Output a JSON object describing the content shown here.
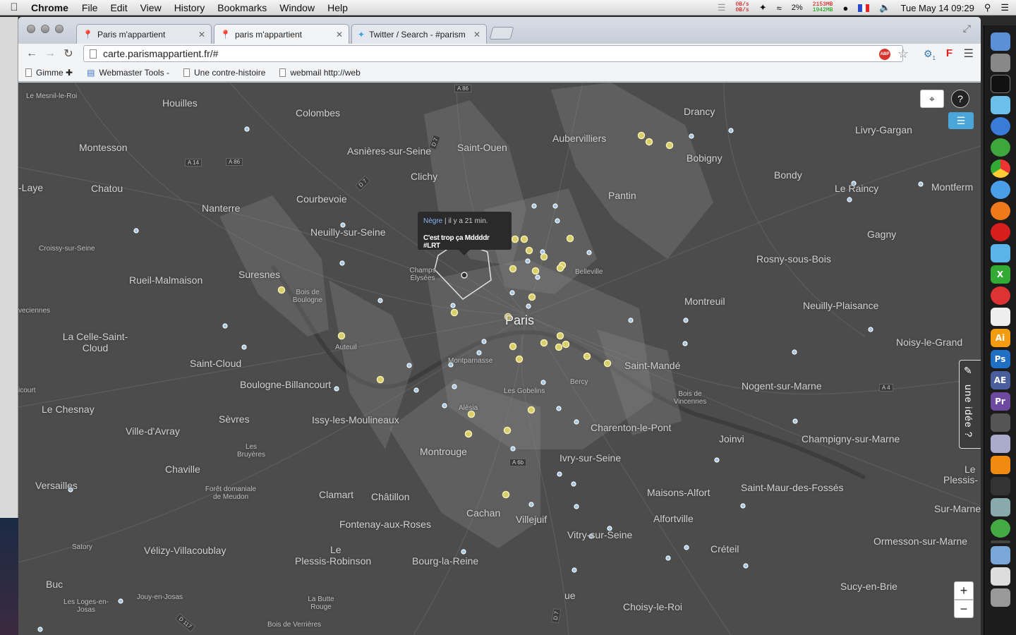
{
  "menubar": {
    "apple": "",
    "app": "Chrome",
    "items": [
      "File",
      "Edit",
      "View",
      "History",
      "Bookmarks",
      "Window",
      "Help"
    ],
    "net_up": "0B/s",
    "net_down": "0B/s",
    "mem_used": "2153MB",
    "mem_free": "1942MB",
    "battery": "2%",
    "datetime": "Tue May 14  09:29"
  },
  "tabs": [
    {
      "title": "Paris m'appartient",
      "active": false
    },
    {
      "title": "paris m'appartient",
      "active": true
    },
    {
      "title": "Twitter / Search - #parism",
      "active": false
    }
  ],
  "toolbar": {
    "url": "carte.parismappartient.fr/#",
    "abp_label": "ABP",
    "ext_badge": "1",
    "ext_f": "F"
  },
  "bookmarks": [
    {
      "label": "Gimme ✚"
    },
    {
      "label": "Webmaster Tools -"
    },
    {
      "label": "Une contre-histoire"
    },
    {
      "label": "webmail http://web"
    }
  ],
  "map": {
    "tooltip": {
      "user": "Nègre",
      "time": "il y a 21 min.",
      "message": "C'est trop ça Mddddr #LRT"
    },
    "idea_button": "une idée ?",
    "zoom_in": "+",
    "zoom_out": "−",
    "locate": "⌖",
    "help": "?",
    "list": "☰",
    "places": [
      {
        "name": "Le Mesnil-le-Roi",
        "cls": "small"
      },
      {
        "name": "Houilles"
      },
      {
        "name": "Colombes"
      },
      {
        "name": "Drancy"
      },
      {
        "name": "Montesson"
      },
      {
        "name": "Asnières-sur-Seine"
      },
      {
        "name": "Saint-Ouen"
      },
      {
        "name": "Aubervilliers"
      },
      {
        "name": "Livry-Gargan"
      },
      {
        "name": "Bobigny"
      },
      {
        "name": "-Laye"
      },
      {
        "name": "Chatou"
      },
      {
        "name": "Clichy"
      },
      {
        "name": "Bondy"
      },
      {
        "name": "Le Raincy"
      },
      {
        "name": "Montferm"
      },
      {
        "name": "Pantin"
      },
      {
        "name": "Nanterre"
      },
      {
        "name": "Courbevoie"
      },
      {
        "name": "Neuilly-sur-Seine"
      },
      {
        "name": "Croissy-sur-Seine",
        "cls": "small"
      },
      {
        "name": "Gagny"
      },
      {
        "name": "Rosny-sous-Bois"
      },
      {
        "name": "Suresnes"
      },
      {
        "name": "Rueil-Malmaison"
      },
      {
        "name": "Champs Élysées",
        "cls": "small"
      },
      {
        "name": "Belleville",
        "cls": "small"
      },
      {
        "name": "Bois de Boulogne",
        "cls": "small"
      },
      {
        "name": "Montreuil"
      },
      {
        "name": "Neuilly-Plaisance"
      },
      {
        "name": "veciennes",
        "cls": "small"
      },
      {
        "name": "Paris",
        "cls": "big"
      },
      {
        "name": "La Celle-Saint-Cloud"
      },
      {
        "name": "Auteuil",
        "cls": "small"
      },
      {
        "name": "Noisy-le-Grand"
      },
      {
        "name": "Saint-Cloud"
      },
      {
        "name": "Saint-Mandé"
      },
      {
        "name": "Montparnasse",
        "cls": "small"
      },
      {
        "name": "Boulogne-Billancourt"
      },
      {
        "name": "Bercy",
        "cls": "small"
      },
      {
        "name": "Nogent-sur-Marne"
      },
      {
        "name": "icourt",
        "cls": "small"
      },
      {
        "name": "Les Gobelins",
        "cls": "small"
      },
      {
        "name": "Bois de Vincennes",
        "cls": "small"
      },
      {
        "name": "Le Chesnay"
      },
      {
        "name": "Alésia",
        "cls": "small"
      },
      {
        "name": "Sèvres"
      },
      {
        "name": "Issy-les-Moulineaux"
      },
      {
        "name": "Charenton-le-Pont"
      },
      {
        "name": "Ville-d'Avray"
      },
      {
        "name": "Joinvi"
      },
      {
        "name": "Champigny-sur-Marne"
      },
      {
        "name": "Montrouge"
      },
      {
        "name": "Les Bruyères",
        "cls": "small"
      },
      {
        "name": "Ivry-sur-Seine"
      },
      {
        "name": "Chaville"
      },
      {
        "name": "Le"
      },
      {
        "name": "Plessis-"
      },
      {
        "name": "Versailles"
      },
      {
        "name": "Forêt domaniale de Meudon",
        "cls": "small"
      },
      {
        "name": "Clamart"
      },
      {
        "name": "Châtillon"
      },
      {
        "name": "Maisons-Alfort"
      },
      {
        "name": "Saint-Maur-des-Fossés"
      },
      {
        "name": "Cachan"
      },
      {
        "name": "Sur-Marne"
      },
      {
        "name": "Villejuif"
      },
      {
        "name": "Fontenay-aux-Roses"
      },
      {
        "name": "Alfortville"
      },
      {
        "name": "Vitry-sur-Seine"
      },
      {
        "name": "Satory",
        "cls": "small"
      },
      {
        "name": "Vélizy-Villacoublay"
      },
      {
        "name": "Le"
      },
      {
        "name": "Créteil"
      },
      {
        "name": "Ormesson-sur-Marne"
      },
      {
        "name": "Plessis-Robinson"
      },
      {
        "name": "Bourg-la-Reine"
      },
      {
        "name": "Buc"
      },
      {
        "name": "Sucy-en-Brie"
      },
      {
        "name": "Jouy-en-Josas",
        "cls": "small"
      },
      {
        "name": "ue"
      },
      {
        "name": "Les Loges-en-Josas",
        "cls": "small"
      },
      {
        "name": "La Butte Rouge",
        "cls": "small"
      },
      {
        "name": "Choisy-le-Roi"
      },
      {
        "name": "Bois de Verrières",
        "cls": "small"
      }
    ],
    "roads": [
      "A 86",
      "A 14",
      "A 86",
      "A 4",
      "A 6b",
      "D 7",
      "D 7",
      "D 117",
      "D 7"
    ]
  },
  "colors": {
    "map_bg": "#4d4d4d",
    "marker_yellow": "#d8cf6a",
    "marker_blue": "#9fc3ea",
    "accent_blue": "#4aa6d8"
  }
}
